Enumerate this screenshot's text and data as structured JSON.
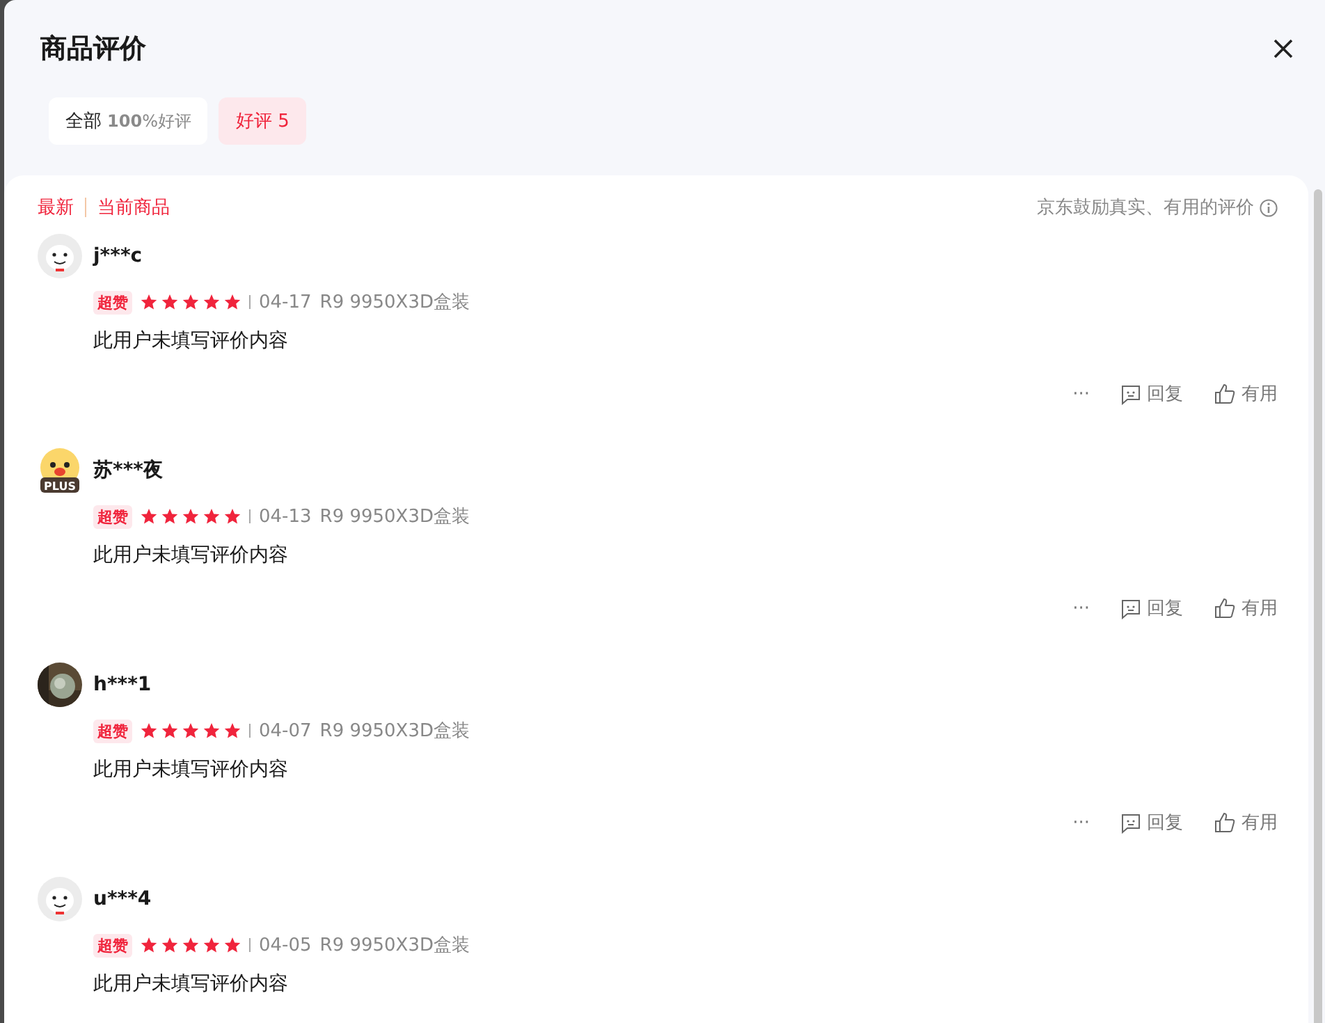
{
  "dialog": {
    "title": "商品评价"
  },
  "filters": [
    {
      "label": "全部",
      "rate": "**100**%好评",
      "selected": false
    },
    {
      "label": "好评 5",
      "selected": true
    }
  ],
  "sort": [
    {
      "label": "最新",
      "selected": true
    },
    {
      "label": "当前商品",
      "selected": true
    }
  ],
  "notice": "京东鼓励真实、有用的评价",
  "reviews": [
    {
      "avatar": {
        "kind": "dog"
      },
      "name": "j***c",
      "badge": "超赞",
      "stars": 5,
      "date": "04-17",
      "product": "R9 9950X3D盒装",
      "text": "此用户未填写评价内容",
      "actions": {
        "more": "···",
        "reply": "回复",
        "useful": "有用"
      }
    },
    {
      "avatar": {
        "kind": "plus",
        "label": "PLUS"
      },
      "name": "苏***夜",
      "badge": "超赞",
      "stars": 5,
      "date": "04-13",
      "product": "R9 9950X3D盒装",
      "text": "此用户未填写评价内容",
      "actions": {
        "more": "···",
        "reply": "回复",
        "useful": "有用"
      }
    },
    {
      "name": "h***1",
      "badge": "超赞",
      "stars": 5,
      "date": "04-07",
      "product": "R9 9950X3D盒装",
      "text": "此用户未填写评价内容",
      "actions": {
        "more": "···",
        "reply": "回复",
        "useful": "有用"
      }
    },
    {
      "avatar": {
        "kind": "dog"
      },
      "name": "u***4",
      "badge": "超赞",
      "stars": 5,
      "date": "04-05",
      "product": "R9 9950X3D盒装",
      "text": "此用户未填写评价内容"
    }
  ]
}
